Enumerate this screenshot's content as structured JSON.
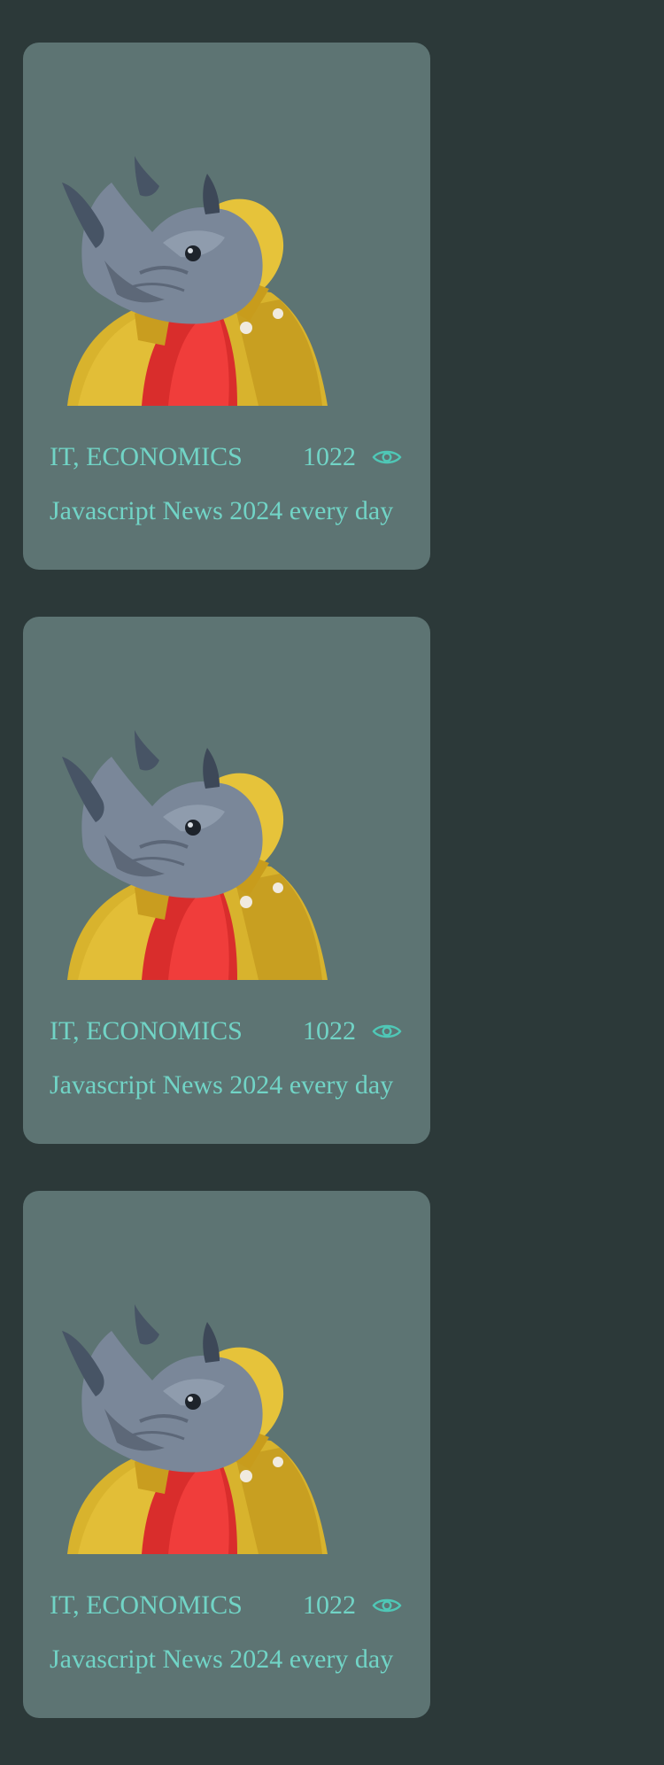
{
  "feed": {
    "cards": [
      {
        "category": "IT, ECONOMICS",
        "views": "1022",
        "title": "Javascript News 2024 every day",
        "image_icon": "rhino-in-yellow-jacket-illustration",
        "view_icon": "eye-icon"
      },
      {
        "category": "IT, ECONOMICS",
        "views": "1022",
        "title": "Javascript News 2024 every day",
        "image_icon": "rhino-in-yellow-jacket-illustration",
        "view_icon": "eye-icon"
      },
      {
        "category": "IT, ECONOMICS",
        "views": "1022",
        "title": "Javascript News 2024 every day",
        "image_icon": "rhino-in-yellow-jacket-illustration",
        "view_icon": "eye-icon"
      }
    ]
  },
  "colors": {
    "page_background": "#2c3939",
    "card_background": "#5d7473",
    "accent_text": "#71d4c6",
    "eye_icon": "#4fc7b6"
  }
}
